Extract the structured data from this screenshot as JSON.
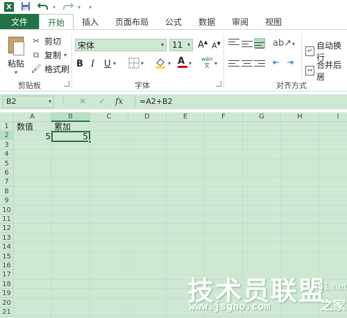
{
  "qat": {
    "app_icon": "X",
    "save_icon": "save-icon",
    "undo_icon": "undo-icon",
    "redo_icon": "redo-icon",
    "customize": "▾"
  },
  "tabs": [
    {
      "label": "文件"
    },
    {
      "label": "开始"
    },
    {
      "label": "插入"
    },
    {
      "label": "页面布局"
    },
    {
      "label": "公式"
    },
    {
      "label": "数据"
    },
    {
      "label": "审阅"
    },
    {
      "label": "视图"
    }
  ],
  "ribbon": {
    "clipboard": {
      "paste": "粘贴",
      "cut": "剪切",
      "copy": "复制",
      "format_painter": "格式刷",
      "group_label": "剪贴板"
    },
    "font": {
      "name": "宋体",
      "size": "11",
      "bold": "B",
      "italic": "I",
      "underline": "U",
      "font_color_letter": "A",
      "phonetic": "wén",
      "group_label": "字体",
      "grow": "A",
      "shrink": "A"
    },
    "alignment": {
      "wrap_text": "自动换行",
      "merge_center": "合并后居",
      "group_label": "对齐方式"
    },
    "colors": {
      "accent": "#217346",
      "sheet_bg": "#cfe8d4",
      "font_color_bar": "#e00000",
      "fill_color_bar": "#ffd800"
    }
  },
  "formula_bar": {
    "name_box": "B2",
    "fx": "fx",
    "formula": "=A2+B2"
  },
  "grid": {
    "columns": [
      "A",
      "B",
      "C",
      "D",
      "E",
      "F",
      "G",
      "H",
      "I"
    ],
    "rows": [
      "1",
      "2",
      "3",
      "4",
      "5",
      "6",
      "7",
      "8",
      "9",
      "10",
      "11",
      "12",
      "13",
      "14",
      "15",
      "16",
      "17",
      "18",
      "19",
      "20",
      "21"
    ],
    "cells": {
      "A1": "数值",
      "B1": "累加",
      "A2": "5",
      "B2": "5"
    },
    "selected_cell": "B2"
  },
  "watermark": {
    "title": "技术员联盟",
    "url": "www.jsgho.com",
    "side": "之家",
    "side_top": "j51.net"
  }
}
